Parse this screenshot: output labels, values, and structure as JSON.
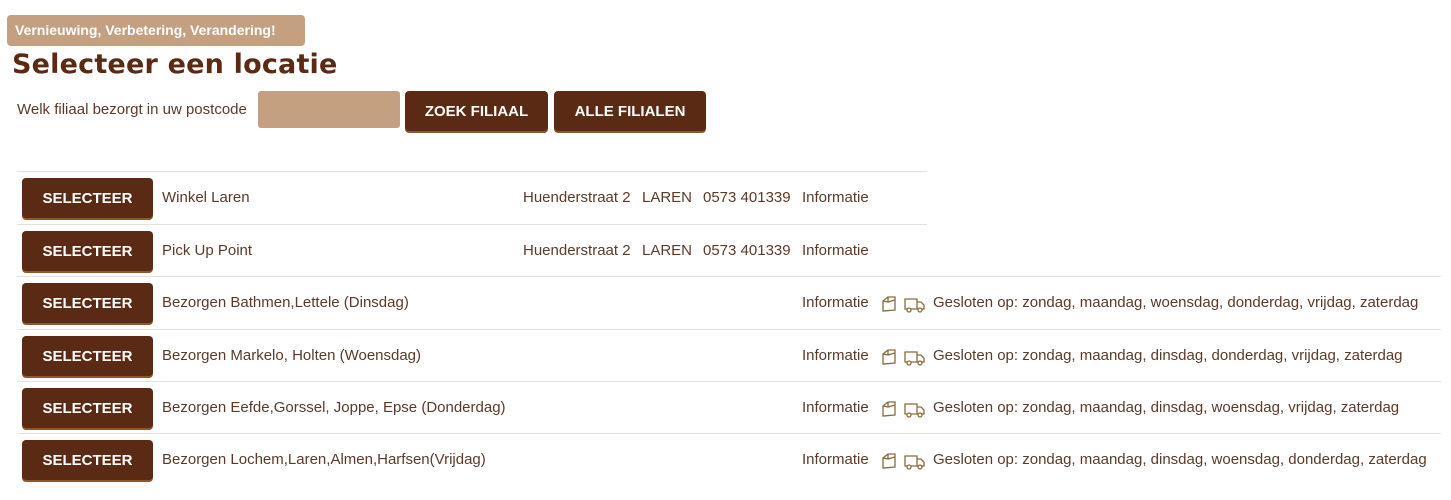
{
  "banner": {
    "text": "Vernieuwing, Verbetering, Verandering!"
  },
  "page_title": "Selecteer een locatie",
  "search": {
    "label": "Welk filiaal bezorgt in uw postcode",
    "input_value": "",
    "search_button": "ZOEK FILIAAL",
    "all_button": "ALLE FILIALEN"
  },
  "colors": {
    "accent": "#5a2a14",
    "light": "#c4a080",
    "text": "#5a3a2a"
  },
  "locations": [
    {
      "select_label": "SELECTEER",
      "name": "Winkel Laren",
      "street": "Huenderstraat 2",
      "city": "LAREN",
      "phone": "0573 401339",
      "info": "Informatie"
    },
    {
      "select_label": "SELECTEER",
      "name": "Pick Up Point",
      "street": "Huenderstraat 2",
      "city": "LAREN",
      "phone": "0573 401339",
      "info": "Informatie"
    },
    {
      "select_label": "SELECTEER",
      "name": "Bezorgen Bathmen,Lettele (Dinsdag)",
      "info": "Informatie",
      "icons": [
        "bread-bag-icon",
        "delivery-truck-icon"
      ],
      "closed": "Gesloten op: zondag, maandag, woensdag, donderdag, vrijdag, zaterdag"
    },
    {
      "select_label": "SELECTEER",
      "name": "Bezorgen Markelo, Holten (Woensdag)",
      "info": "Informatie",
      "icons": [
        "bread-bag-icon",
        "delivery-truck-icon"
      ],
      "closed": "Gesloten op: zondag, maandag, dinsdag, donderdag, vrijdag, zaterdag"
    },
    {
      "select_label": "SELECTEER",
      "name": "Bezorgen Eefde,Gorssel, Joppe, Epse (Donderdag)",
      "info": "Informatie",
      "icons": [
        "bread-bag-icon",
        "delivery-truck-icon"
      ],
      "closed": "Gesloten op: zondag, maandag, dinsdag, woensdag, vrijdag, zaterdag"
    },
    {
      "select_label": "SELECTEER",
      "name": "Bezorgen Lochem,Laren,Almen,Harfsen(Vrijdag)",
      "info": "Informatie",
      "icons": [
        "bread-bag-icon",
        "delivery-truck-icon"
      ],
      "closed": "Gesloten op: zondag, maandag, dinsdag, woensdag, donderdag, zaterdag"
    }
  ]
}
